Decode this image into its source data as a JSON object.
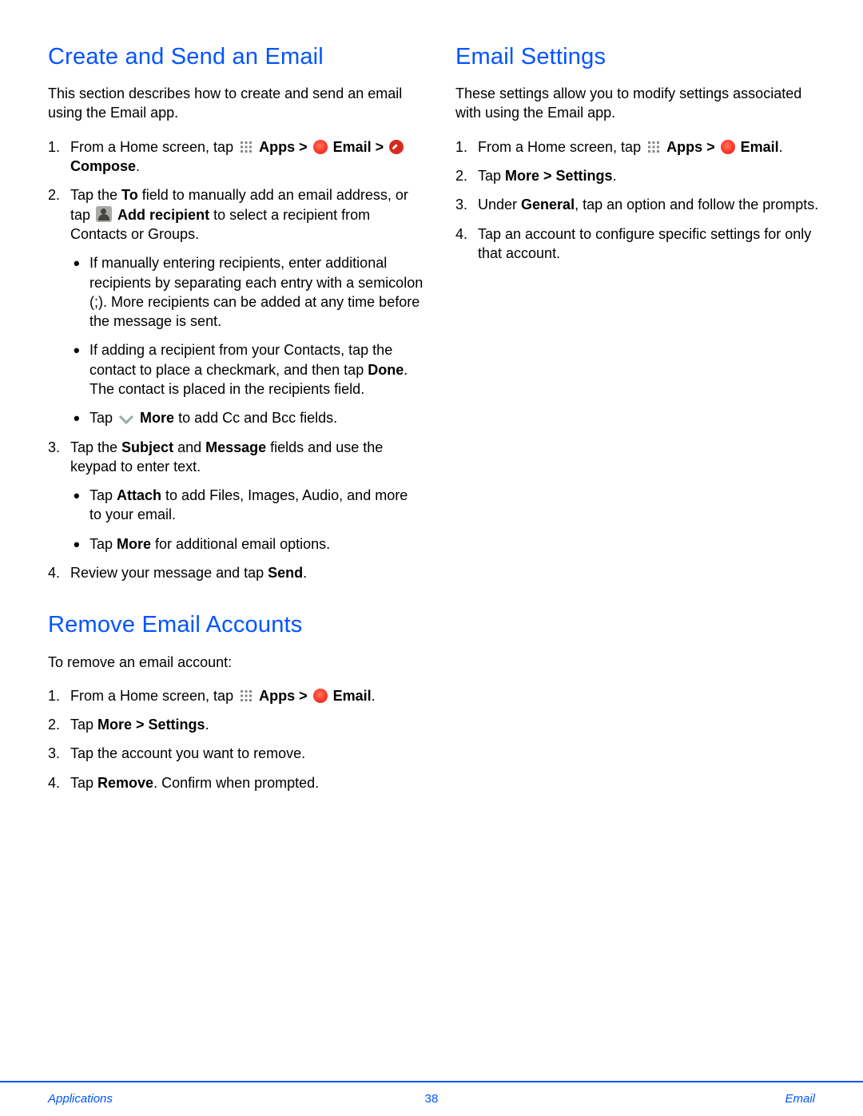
{
  "left": {
    "create": {
      "heading": "Create and Send an Email",
      "intro": "This section describes how to create and send an email using the Email app.",
      "step1_pre": "From a Home screen, tap ",
      "apps_label": "Apps",
      "gt": " > ",
      "email_label": "Email",
      "compose_label": "Compose",
      "step1_end": ".",
      "step2_pre": "Tap the ",
      "to_label": "To",
      "step2_mid": " field to manually add an email address, or tap ",
      "add_recipient_label": "Add recipient",
      "step2_end": " to select a recipient from Contacts or Groups.",
      "bullet2a": "If manually entering recipients, enter additional recipients by separating each entry with a semicolon (;). More recipients can be added at any time before the message is sent.",
      "bullet2b_pre": "If adding a recipient from your Contacts, tap the contact to place a checkmark, and then tap ",
      "done_label": "Done",
      "bullet2b_end": ". The contact is placed in the recipients field.",
      "bullet2c_pre": "Tap ",
      "more_label": "More",
      "bullet2c_end": " to add Cc and Bcc fields.",
      "step3_pre": "Tap the ",
      "subject_label": "Subject",
      "and": " and ",
      "message_label": "Message",
      "step3_end": " fields and use the keypad to enter text.",
      "bullet3a_pre": "Tap ",
      "attach_label": "Attach",
      "bullet3a_end": " to add Files, Images, Audio, and more to your email.",
      "bullet3b_pre": "Tap ",
      "bullet3b_end": " for additional email options.",
      "step4_pre": "Review your message and tap ",
      "send_label": "Send",
      "step4_end": "."
    },
    "remove": {
      "heading": "Remove Email Accounts",
      "intro": "To remove an email account:",
      "step1_pre": "From a Home screen, tap ",
      "apps_label": "Apps",
      "gt": " > ",
      "email_label": "Email",
      "step1_end2": ".",
      "step2_pre": "Tap ",
      "more_settings": "More > Settings",
      "step2_end": ".",
      "step3": "Tap the account you want to remove.",
      "step4_pre": "Tap ",
      "remove_label": "Remove",
      "step4_end": ". Confirm when prompted."
    }
  },
  "right": {
    "settings": {
      "heading": "Email Settings",
      "intro": "These settings allow you to modify settings associated with using the Email app.",
      "step1_pre": "From a Home screen, tap ",
      "apps_label": "Apps",
      "gt": " > ",
      "email_label": "Email",
      "step1_end2": ".",
      "step2_pre": "Tap ",
      "more_settings": "More > Settings",
      "step2_end": ".",
      "step3_pre": "Under ",
      "general_label": "General",
      "step3_end": ", tap an option and follow the prompts.",
      "step4": "Tap an account to configure specific settings for only that account."
    }
  },
  "footer": {
    "left": "Applications",
    "page": "38",
    "right": "Email"
  }
}
